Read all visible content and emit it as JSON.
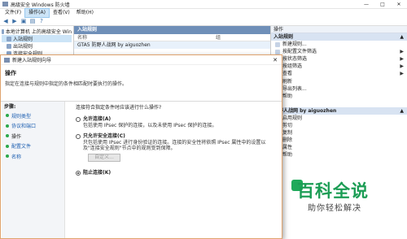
{
  "window": {
    "title": "高级安全 Windows 防火墙",
    "controls": [
      "—",
      "□",
      "✕"
    ]
  },
  "menubar": [
    "文件(F)",
    "操作(A)",
    "查看(V)",
    "帮助(H)"
  ],
  "tree": [
    {
      "label": "本地计算机 上的高级安全 Win"
    },
    {
      "label": "入站规则"
    },
    {
      "label": "出站规则"
    },
    {
      "label": "连接安全规则"
    }
  ],
  "center": {
    "header": "入站规则",
    "column_name": "名称",
    "column_group": "组",
    "rows": [
      {
        "name": "GTA5 防野人战网 by aiguozhen",
        "group": ""
      },
      {
        "name": "",
        "group": ""
      }
    ]
  },
  "actions": {
    "header": "操作",
    "group1": "入站规则",
    "items1": [
      {
        "label": "新建规则...",
        "arrow": ""
      },
      {
        "label": "按配置文件筛选",
        "arrow": "▶"
      },
      {
        "label": "按状态筛选",
        "arrow": "▶"
      },
      {
        "label": "按组筛选",
        "arrow": "▶"
      },
      {
        "label": "查看",
        "arrow": "▶"
      },
      {
        "label": "刷新",
        "arrow": ""
      },
      {
        "label": "导出列表...",
        "arrow": ""
      },
      {
        "label": "帮助",
        "arrow": ""
      }
    ],
    "group2": "防野人战网 by aiguozhen",
    "items2": [
      {
        "label": "启用规则"
      },
      {
        "label": "剪切"
      },
      {
        "label": "复制"
      },
      {
        "label": "删除"
      },
      {
        "label": "属性"
      },
      {
        "label": "帮助"
      }
    ]
  },
  "wizard": {
    "title": "新建入站规则向导",
    "heading": "操作",
    "description": "指定在连接与规则中指定的条件相匹配时要执行的操作。",
    "steps_title": "步骤:",
    "steps": [
      "规则类型",
      "协议和端口",
      "操作",
      "配置文件",
      "名称"
    ],
    "question": "连接符合指定条件时应该进行什么操作?",
    "options": [
      {
        "label": "允许连接(A)",
        "desc": "包括使用 IPsec 保护的连接，以及未使用 IPsec 保护的连接。",
        "checked": false
      },
      {
        "label": "只允许安全连接(C)",
        "desc": "只包括使用 IPsec 进行身份验证的连接。连接的安全性将依照 IPsec 属性中的设置以及\"连接安全规则\"节点中的规则受到保障。",
        "checked": false
      },
      {
        "label": "阻止连接(K)",
        "desc": "",
        "checked": true
      }
    ],
    "customize_label": "自定义..."
  },
  "watermark": {
    "title": "百科全说",
    "subtitle": "助你轻松解决"
  }
}
